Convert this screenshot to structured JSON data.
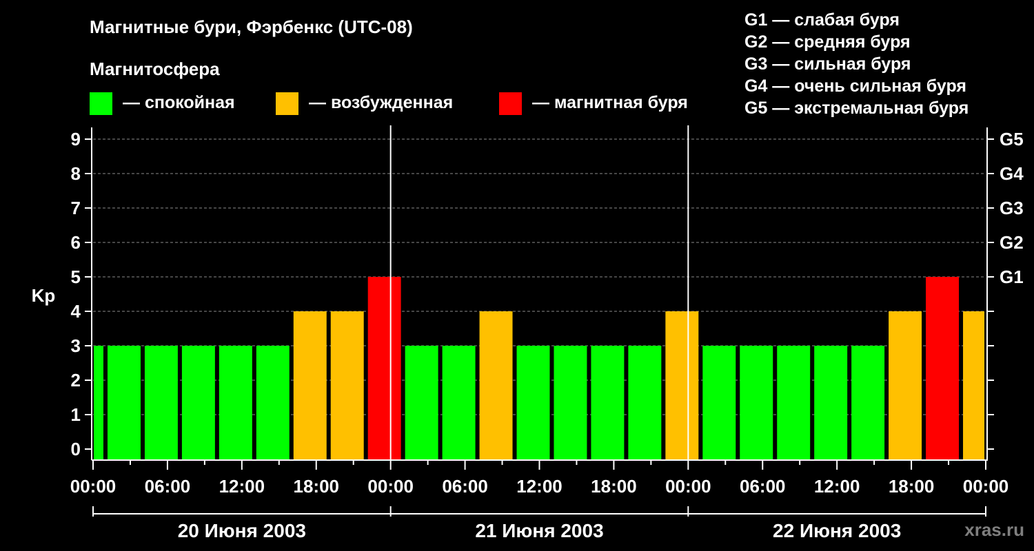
{
  "title": "Магнитные бури, Фэрбенкс (UTC-08)",
  "legend": {
    "heading": "Магнитосфера",
    "items": [
      {
        "label": "— спокойная",
        "color": "#00ff00"
      },
      {
        "label": "— возбужденная",
        "color": "#ffc000"
      },
      {
        "label": "— магнитная буря",
        "color": "#ff0000"
      }
    ]
  },
  "storm_scale": [
    "G1 — слабая буря",
    "G2 — средняя буря",
    "G3 — сильная буря",
    "G4 — очень сильная буря",
    "G5 — экстремальная буря"
  ],
  "watermark": "xras.ru",
  "chart_data": {
    "type": "bar",
    "title": "Магнитные бури, Фэрбенкс (UTC-08)",
    "ylabel": "Kp",
    "xlabel": "",
    "ylim": [
      0,
      9
    ],
    "y_ticks": [
      "0",
      "1",
      "2",
      "3",
      "4",
      "5",
      "6",
      "7",
      "8",
      "9"
    ],
    "right_axis_labels": [
      {
        "value": 5,
        "label": "G1"
      },
      {
        "value": 6,
        "label": "G2"
      },
      {
        "value": 7,
        "label": "G3"
      },
      {
        "value": 8,
        "label": "G4"
      },
      {
        "value": 9,
        "label": "G5"
      }
    ],
    "x_tick_labels": [
      "00:00",
      "06:00",
      "12:00",
      "18:00",
      "00:00",
      "06:00",
      "12:00",
      "18:00",
      "00:00",
      "06:00",
      "12:00",
      "18:00",
      "00:00"
    ],
    "x_tick_hours": [
      0,
      6,
      12,
      18,
      24,
      30,
      36,
      42,
      48,
      54,
      60,
      66,
      72
    ],
    "days": [
      {
        "label": "20 Июня 2003",
        "start_hour": 0,
        "end_hour": 24
      },
      {
        "label": "21 Июня 2003",
        "start_hour": 24,
        "end_hour": 48
      },
      {
        "label": "22 Июня 2003",
        "start_hour": 48,
        "end_hour": 72
      }
    ],
    "grid": true,
    "bar_intervals_hours": [
      [
        0,
        1
      ],
      [
        1,
        4
      ],
      [
        4,
        7
      ],
      [
        7,
        10
      ],
      [
        10,
        13
      ],
      [
        13,
        16
      ],
      [
        16,
        19
      ],
      [
        19,
        22
      ],
      [
        22,
        25
      ],
      [
        25,
        28
      ],
      [
        28,
        31
      ],
      [
        31,
        34
      ],
      [
        34,
        37
      ],
      [
        37,
        40
      ],
      [
        40,
        43
      ],
      [
        43,
        46
      ],
      [
        46,
        49
      ],
      [
        49,
        52
      ],
      [
        52,
        55
      ],
      [
        55,
        58
      ],
      [
        58,
        61
      ],
      [
        61,
        64
      ],
      [
        64,
        67
      ],
      [
        67,
        70
      ],
      [
        70,
        72
      ]
    ],
    "values": [
      3,
      3,
      3,
      3,
      3,
      3,
      4,
      4,
      5,
      3,
      3,
      4,
      3,
      3,
      3,
      3,
      4,
      3,
      3,
      3,
      3,
      3,
      4,
      5,
      4
    ],
    "level_colors": {
      "quiet": "#00ff00",
      "active": "#ffc000",
      "storm": "#ff0000"
    }
  }
}
